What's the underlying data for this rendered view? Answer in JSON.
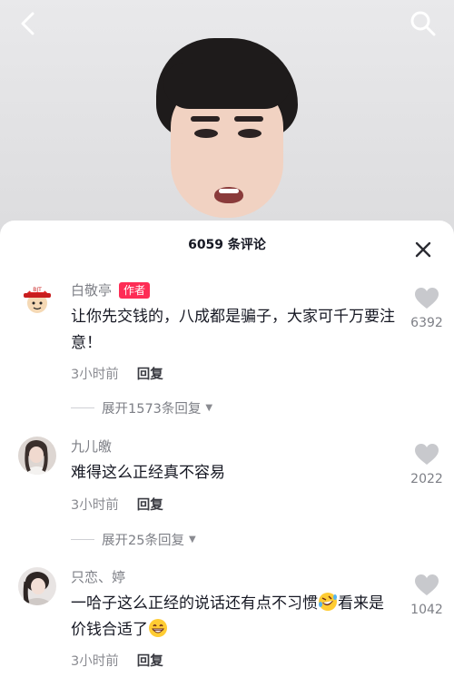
{
  "video": {
    "back_icon": "chevron-left-icon",
    "search_icon": "search-icon"
  },
  "comments_panel": {
    "title": "6059 条评论",
    "close_icon": "close-icon"
  },
  "comments": [
    {
      "username": "白敬亭",
      "badge": "作者",
      "text": "让你先交钱的，八成都是骗子，大家可千万要注意！",
      "time": "3小时前",
      "reply_label": "回复",
      "likes": "6392",
      "expand_label": "展开1573条回复"
    },
    {
      "username": "九儿皦",
      "text": "难得这么正经真不容易",
      "time": "3小时前",
      "reply_label": "回复",
      "likes": "2022",
      "expand_label": "展开25条回复"
    },
    {
      "username": "只恋、婷",
      "text_part1": "一哈子这么正经的说话还有点不习惯",
      "text_part2": "看来是价钱合适了",
      "time": "3小时前",
      "reply_label": "回复",
      "likes": "1042"
    }
  ],
  "colors": {
    "accent": "#fe2c55",
    "text": "#161823",
    "muted": "#8a8b91"
  }
}
